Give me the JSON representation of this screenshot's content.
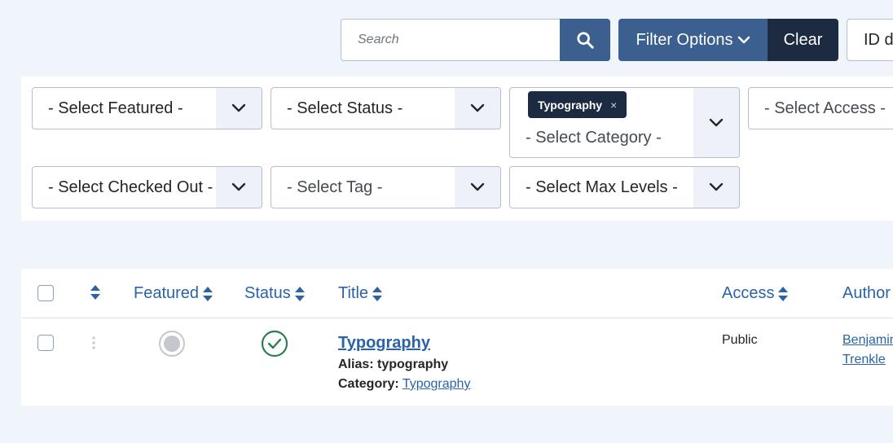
{
  "toolbar": {
    "search_placeholder": "Search",
    "filter_options_label": "Filter Options",
    "clear_label": "Clear",
    "sort_value": "ID descending"
  },
  "filters": {
    "featured": "- Select Featured -",
    "status": "- Select Status -",
    "category_chip": "Typography",
    "category_chip_remove": "×",
    "category": "- Select Category -",
    "access": "- Select Access -",
    "checked_out": "- Select Checked Out -",
    "tag": "- Select Tag -",
    "max_levels": "- Select Max Levels -"
  },
  "table": {
    "headers": {
      "featured": "Featured",
      "status": "Status",
      "title": "Title",
      "access": "Access",
      "author": "Author"
    },
    "rows": [
      {
        "title": "Typography",
        "alias_label": "Alias:",
        "alias": "typography",
        "category_label": "Category:",
        "category": "Typography",
        "access": "Public",
        "author_line1": "Benjamin",
        "author_line2": "Trenkle",
        "featured": false,
        "status": "published"
      }
    ]
  },
  "colors": {
    "primary": "#3b5f8f",
    "dark": "#1c2a42",
    "link": "#2a63a6",
    "published": "#2e7d4f",
    "background": "#f0f4fb"
  },
  "icons": {
    "search": "search-icon",
    "chevron": "chevron-down-icon",
    "sort": "sort-icon",
    "published": "check-circle-icon",
    "unfeatured": "circle-icon",
    "drag": "drag-handle-icon"
  }
}
